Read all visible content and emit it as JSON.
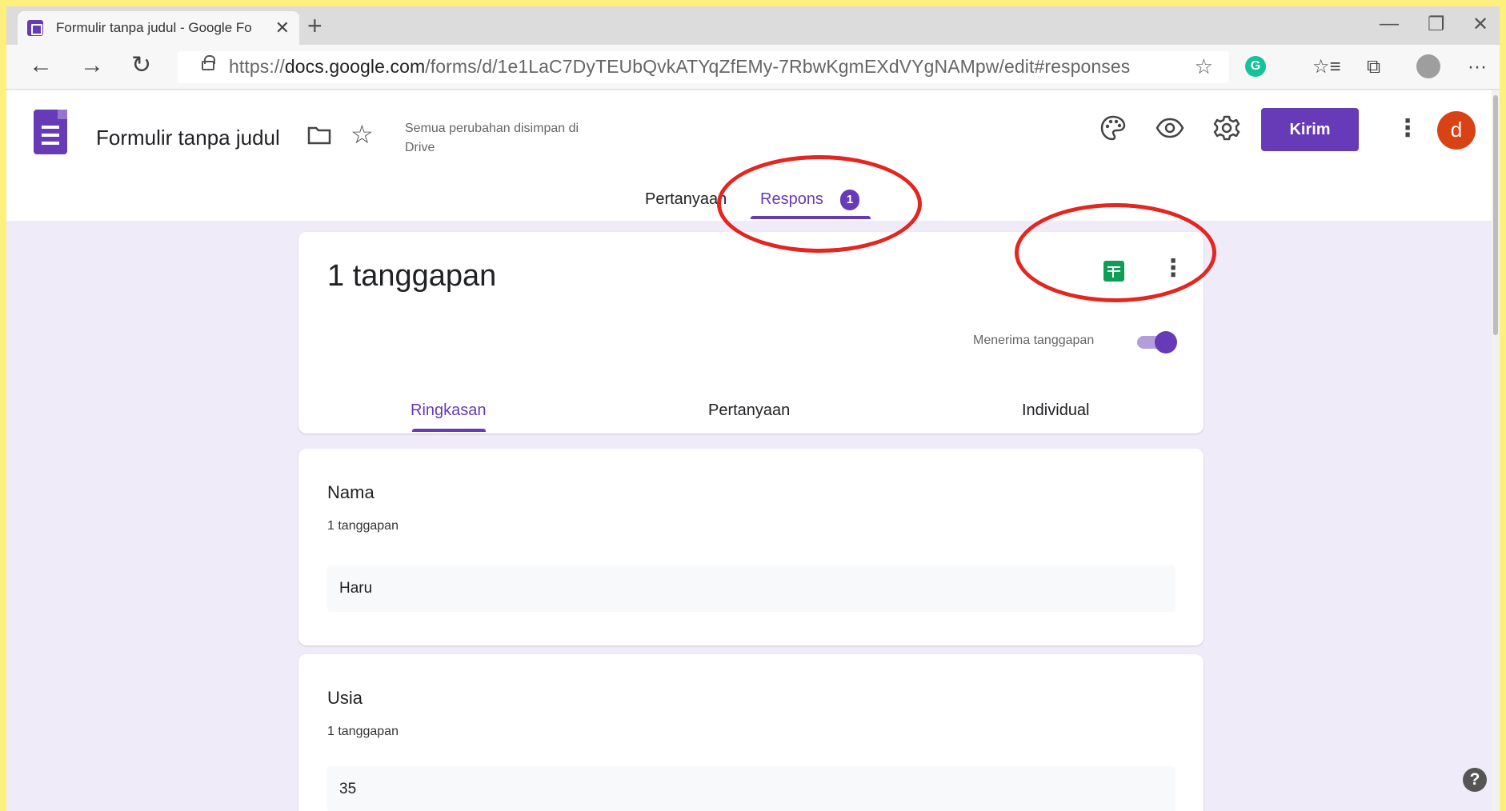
{
  "browser": {
    "tab_title": "Formulir tanpa judul - Google Fo",
    "tab_close": "✕",
    "new_tab": "+",
    "url_prefix": "https://",
    "url_host": "docs.google.com",
    "url_path": "/forms/d/1e1LaC7DyTEUbQvkATYqZfEMy-7RbwKgmEXdVYgNAMpw/edit#responses",
    "window_controls": {
      "minimize": "—",
      "restore": "❐",
      "close": "✕"
    },
    "nav": {
      "back": "←",
      "forward": "→",
      "reload": "↻"
    },
    "extensions": {
      "grammarly": "G",
      "favorites": "☆≡",
      "collections": "⧉",
      "menu": "···"
    }
  },
  "header": {
    "form_title": "Formulir tanpa judul",
    "saved_status": "Semua perubahan disimpan di Drive",
    "send_label": "Kirim",
    "avatar_letter": "d",
    "more": "⋮"
  },
  "main_tabs": {
    "questions": "Pertanyaan",
    "responses": "Respons",
    "responses_badge": "1"
  },
  "summary": {
    "response_count": "1 tanggapan",
    "accepting_label": "Menerima tanggapan",
    "accepting": true,
    "more": "⋮",
    "subtabs": [
      "Ringkasan",
      "Pertanyaan",
      "Individual"
    ]
  },
  "questions": [
    {
      "title": "Nama",
      "count": "1 tanggapan",
      "answer": "Haru"
    },
    {
      "title": "Usia",
      "count": "1 tanggapan",
      "answer": "35"
    }
  ],
  "help": "?",
  "colors": {
    "accent": "#673ab7",
    "background": "#f0ebf8",
    "sheets": "#0f9d58",
    "annotation": "#e3261f",
    "border": "#fdf07c"
  }
}
